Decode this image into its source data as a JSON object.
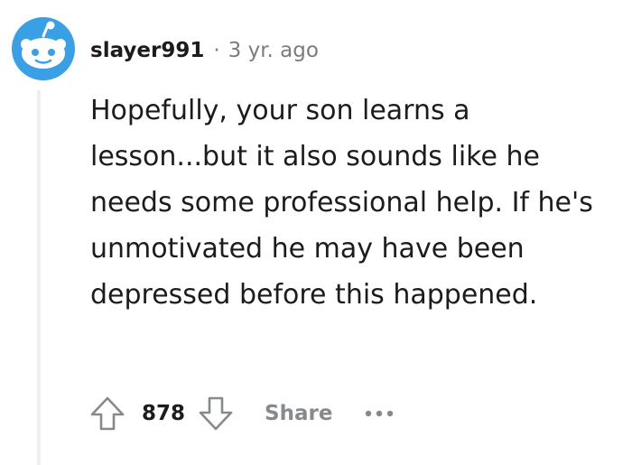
{
  "comment": {
    "username": "slayer991",
    "separator": "·",
    "time": "3 yr. ago",
    "body": "Hopefully, your son learns a lesson...but it also sounds like he needs some professional help. If he's unmotivated he may have been depressed before this happened.",
    "score": "878",
    "share_label": "Share",
    "icons": {
      "avatar": "snoo-avatar-icon",
      "upvote": "upvote-arrow-icon",
      "downvote": "downvote-arrow-icon",
      "more": "more-options-icon"
    }
  },
  "colors": {
    "avatar_blue": "#3aa0e6",
    "text": "#1c1c1c",
    "muted": "#878a8c",
    "thread_line": "#edeff1"
  }
}
